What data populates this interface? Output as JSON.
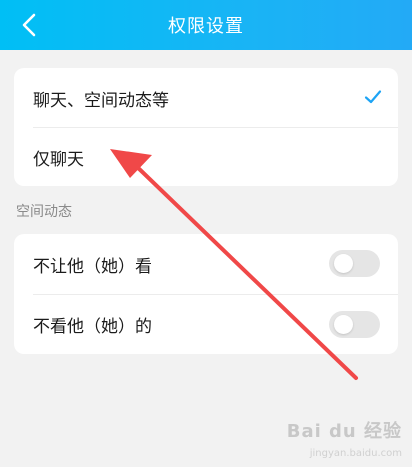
{
  "header": {
    "title": "权限设置",
    "back_icon": "chevron-left-icon"
  },
  "chat_permission": {
    "options": [
      {
        "label": "聊天、空间动态等",
        "selected": true
      },
      {
        "label": "仅聊天",
        "selected": false
      }
    ],
    "check_icon": "checkmark-icon"
  },
  "moments": {
    "section_title": "空间动态",
    "items": [
      {
        "label": "不让他（她）看",
        "toggle_on": false
      },
      {
        "label": "不看他（她）的",
        "toggle_on": false
      }
    ]
  },
  "colors": {
    "header_start": "#00bff5",
    "header_end": "#23aaf6",
    "accent": "#1da4f5",
    "annotation_arrow": "#f04848",
    "background": "#f2f2f2"
  },
  "watermark": {
    "text": "Bai du 经验",
    "sub": "jingyan.baidu.com"
  }
}
